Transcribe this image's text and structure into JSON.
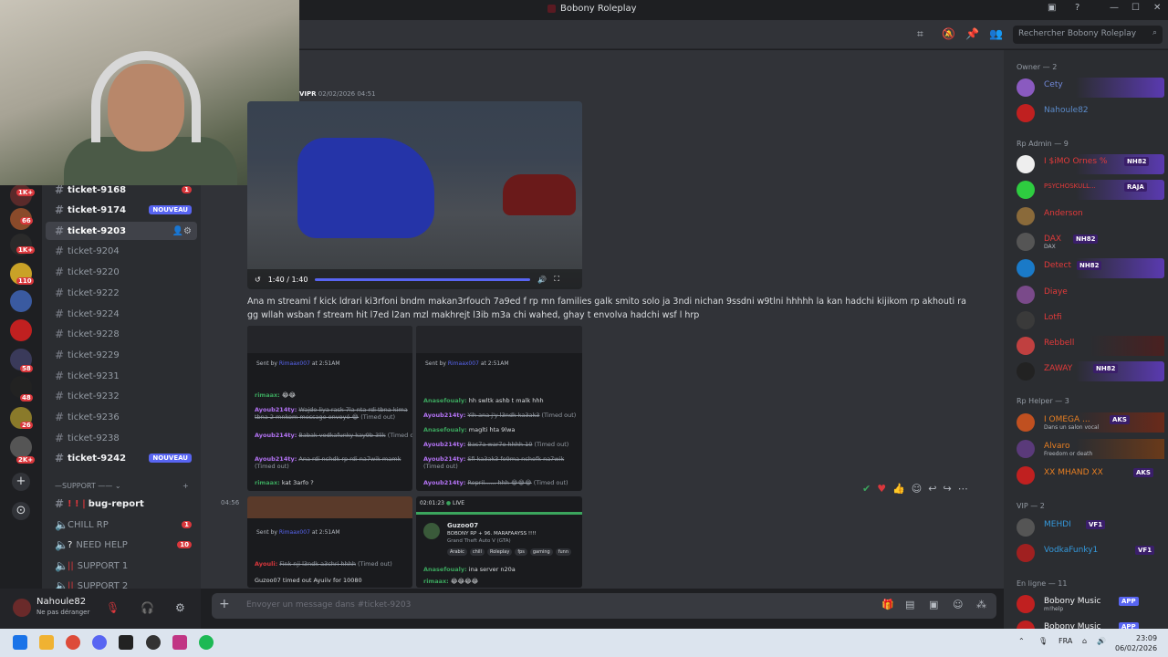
{
  "window": {
    "title": "Bobony Roleplay"
  },
  "header": {
    "search_placeholder": "Rechercher Bobony Roleplay"
  },
  "channels": [
    {
      "name": "ticket-9168",
      "badge": "1",
      "bold": true
    },
    {
      "name": "ticket-9174",
      "pill": "NOUVEAU",
      "bold": true
    },
    {
      "name": "ticket-9203",
      "active": true
    },
    {
      "name": "ticket-9204"
    },
    {
      "name": "ticket-9220"
    },
    {
      "name": "ticket-9222"
    },
    {
      "name": "ticket-9224"
    },
    {
      "name": "ticket-9228"
    },
    {
      "name": "ticket-9229"
    },
    {
      "name": "ticket-9231"
    },
    {
      "name": "ticket-9232"
    },
    {
      "name": "ticket-9236"
    },
    {
      "name": "ticket-9238"
    },
    {
      "name": "ticket-9242",
      "pill": "NOUVEAU",
      "bold": true
    }
  ],
  "support_category": "—SUPPORT ——",
  "support_channels": [
    {
      "name": "bug-report",
      "prefix": "! ! |",
      "bold": true
    },
    {
      "name": "CHILL RP",
      "badge": "1"
    },
    {
      "name": "NEED HELP",
      "prefix": "?",
      "badge": "10"
    },
    {
      "name": "SUPPORT 1",
      "prefix": "||"
    },
    {
      "name": "SUPPORT 2",
      "prefix": "||"
    }
  ],
  "rail_badges": [
    "1K+",
    "66",
    "1K+",
    "110",
    "58",
    "48",
    "26",
    "2K+"
  ],
  "user": {
    "name": "Nahoule82",
    "status": "Ne pas déranger"
  },
  "message": {
    "author_short": "VIPR",
    "timestamp": "02/02/2026 04:51",
    "video_time": "1:40 / 1:40",
    "text": "Ana m streami f kick ldrari ki3rfoni bndm makan3rfouch 7a9ed f rp mn families galk smito solo ja 3ndi nichan 9ssdni w9tlni hhhhh la kan hadchi kijikom rp akhouti ra gg wllah wsban f stream hit l7ed l2an mzl makhrejt l3ib m3a chi wahed, ghay t envolva hadchi wsf l hrp",
    "second_time": "04:56"
  },
  "thumbs": {
    "t1": {
      "sent_by": "Sent by",
      "sender": "Rimaax007",
      "sent_time": "at 2:51AM",
      "lines": [
        {
          "user": "rimaax:",
          "text": "😂😂"
        },
        {
          "user": "Ayoub214ty:",
          "text": "Wajde liya rask 7la nta rdi tbna kima tbna 2 mnkom message envoyé 😂",
          "suffix": "(Timed out)"
        },
        {
          "user": "Ayoub214ty:",
          "text": "Babak vodkafunky kay9b 3lik",
          "suffix": "(Timed out)"
        },
        {
          "user": "Ayoub214ty:",
          "text": "Ana rdi nchdk rp rdi na7wik mamk",
          "suffix": "(Timed out)"
        },
        {
          "user": "rimaax:",
          "text": "kat 3arfo ?"
        }
      ]
    },
    "t2": {
      "sent_by": "Sent by",
      "sender": "Rimaax007",
      "sent_time": "at 2:51AM",
      "lines": [
        {
          "user": "Anasefoualy:",
          "text": "hh swltk ashb t malk hhh"
        },
        {
          "user": "Ayoub214ty:",
          "text": "Yih ana j'y l3ndk ka3ak3",
          "suffix": "(Timed out)"
        },
        {
          "user": "Anasefoualy:",
          "text": "maglti hta 9lwa"
        },
        {
          "user": "Ayoub214ty:",
          "text": "Bas7a war7e hhhh 10",
          "suffix": "(Timed out)"
        },
        {
          "user": "Ayoub214ty:",
          "text": "Sfi ka3ak3 fo9ma nchofk na7wik",
          "suffix": "(Timed out)"
        },
        {
          "user": "Ayoub214ty:",
          "text": "Repril...... hhh 😂😂😂",
          "suffix": "(Timed out)"
        }
      ]
    },
    "t3": {
      "sent_by": "Sent by",
      "sender": "Rimaax007",
      "sent_time": "at 2:51AM",
      "lines": [
        {
          "user": "Ayouli:",
          "text": "Fink nji l3ndk a3chri hhhh",
          "suffix": "(Timed out)"
        },
        {
          "user": "",
          "text": "Guzoo07 timed out Ayuiiv for 10080"
        }
      ]
    },
    "t4": {
      "live_time": "02:01:23",
      "live_label": "LIVE",
      "streamer": "Guzoo07",
      "stream_title": "BOBONY RP + 96. MARAFAAYSS !!!!",
      "game": "Grand Theft Auto V (GTA)",
      "tags": [
        "Arabic",
        "chill",
        "Roleplay",
        "fps",
        "gaming",
        "funn"
      ],
      "lines": [
        {
          "user": "Anasefoualy:",
          "text": "ina server n20a"
        },
        {
          "user": "rimaax:",
          "text": "😂😂😂😂"
        }
      ]
    }
  },
  "composer": {
    "placeholder": "Envoyer un message dans #ticket-9203"
  },
  "members": {
    "owner_header": "Owner — 2",
    "owners": [
      {
        "name": "Cety",
        "color": "#7289da",
        "highlight": true
      },
      {
        "name": "Nahoule82",
        "color": "#5b8ac8"
      }
    ],
    "admin_header": "Rp Admin — 9",
    "admins": [
      {
        "name": "I $iMO Ornes %",
        "color": "#e23a3a",
        "tag": "NH82",
        "highlight": true
      },
      {
        "name": "PSYCHOSKULL...",
        "color": "#e23a3a",
        "tag": "RAJA",
        "highlight": true
      },
      {
        "name": "Anderson",
        "color": "#e23a3a"
      },
      {
        "name": "DAX",
        "color": "#e23a3a",
        "tag": "NH82",
        "sub": "DAX"
      },
      {
        "name": "Detect",
        "color": "#e23a3a",
        "tag": "NH82",
        "highlight": true
      },
      {
        "name": "Diaye",
        "color": "#e23a3a"
      },
      {
        "name": "Lotfi",
        "color": "#e23a3a"
      },
      {
        "name": "Rebbell",
        "color": "#e23a3a"
      },
      {
        "name": "ZAWAY",
        "color": "#e23a3a",
        "tag": "NH82",
        "highlight": true
      }
    ],
    "helper_header": "Rp Helper — 3",
    "helpers": [
      {
        "name": "I OMEGA ...",
        "color": "#e67e22",
        "tag": "AKS",
        "sub": "Dans un salon vocal"
      },
      {
        "name": "Alvaro",
        "color": "#e67e22",
        "sub": "Freedom or death"
      },
      {
        "name": "XX MHAND XX",
        "color": "#e67e22",
        "tag": "AKS"
      }
    ],
    "vip_header": "VIP — 2",
    "vips": [
      {
        "name": "MEHDI",
        "color": "#3498db",
        "tag": "VF1"
      },
      {
        "name": "VodkaFunky1",
        "color": "#3498db",
        "tag": "VF1"
      }
    ],
    "online_header": "En ligne — 11",
    "online": [
      {
        "name": "Bobony Music",
        "color": "#dbdee1",
        "tag": "APP",
        "sub": "m!help"
      },
      {
        "name": "Bobony Music",
        "color": "#dbdee1",
        "tag": "APP"
      }
    ]
  },
  "taskbar": {
    "lang": "FRA",
    "time": "23:09",
    "date": "06/02/2026"
  }
}
